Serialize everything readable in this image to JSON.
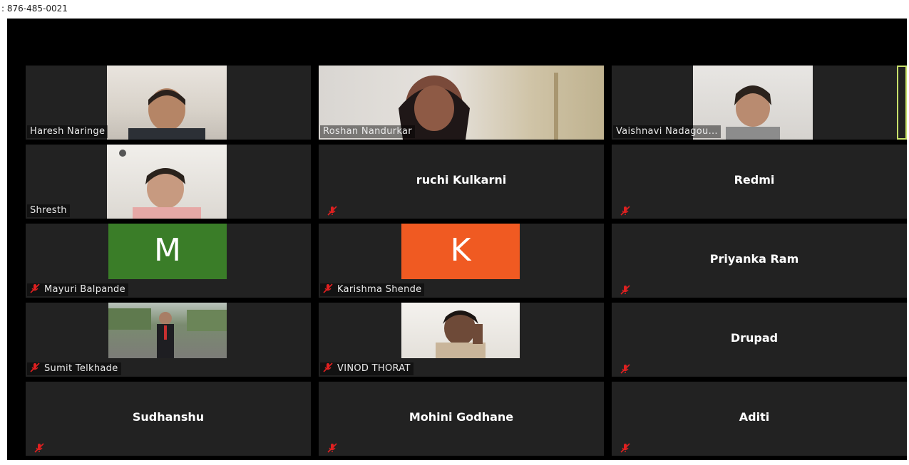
{
  "header": {
    "phone_text": ": 876-485-0021"
  },
  "participants": [
    {
      "name": "Haresh Naringe"
    },
    {
      "name": "Roshan Nandurkar"
    },
    {
      "name": "Vaishnavi Nadagou..."
    },
    {
      "name": "Shresth"
    },
    {
      "name": "ruchi Kulkarni"
    },
    {
      "name": "Redmi"
    },
    {
      "name": "Mayuri Balpande",
      "avatar_letter": "M",
      "avatar_color": "#3a7d28"
    },
    {
      "name": "Karishma Shende",
      "avatar_letter": "K",
      "avatar_color": "#f05a22"
    },
    {
      "name": "Priyanka Ram"
    },
    {
      "name": "Sumit Telkhade"
    },
    {
      "name": "VINOD THORAT"
    },
    {
      "name": "Drupad"
    },
    {
      "name": "Sudhanshu"
    },
    {
      "name": "Mohini Godhane"
    },
    {
      "name": "Aditi"
    }
  ],
  "colors": {
    "tile_bg": "#222222",
    "stage_bg": "#000000",
    "mute_icon": "#e02020",
    "active_speaker_border": "#c8e06a"
  }
}
